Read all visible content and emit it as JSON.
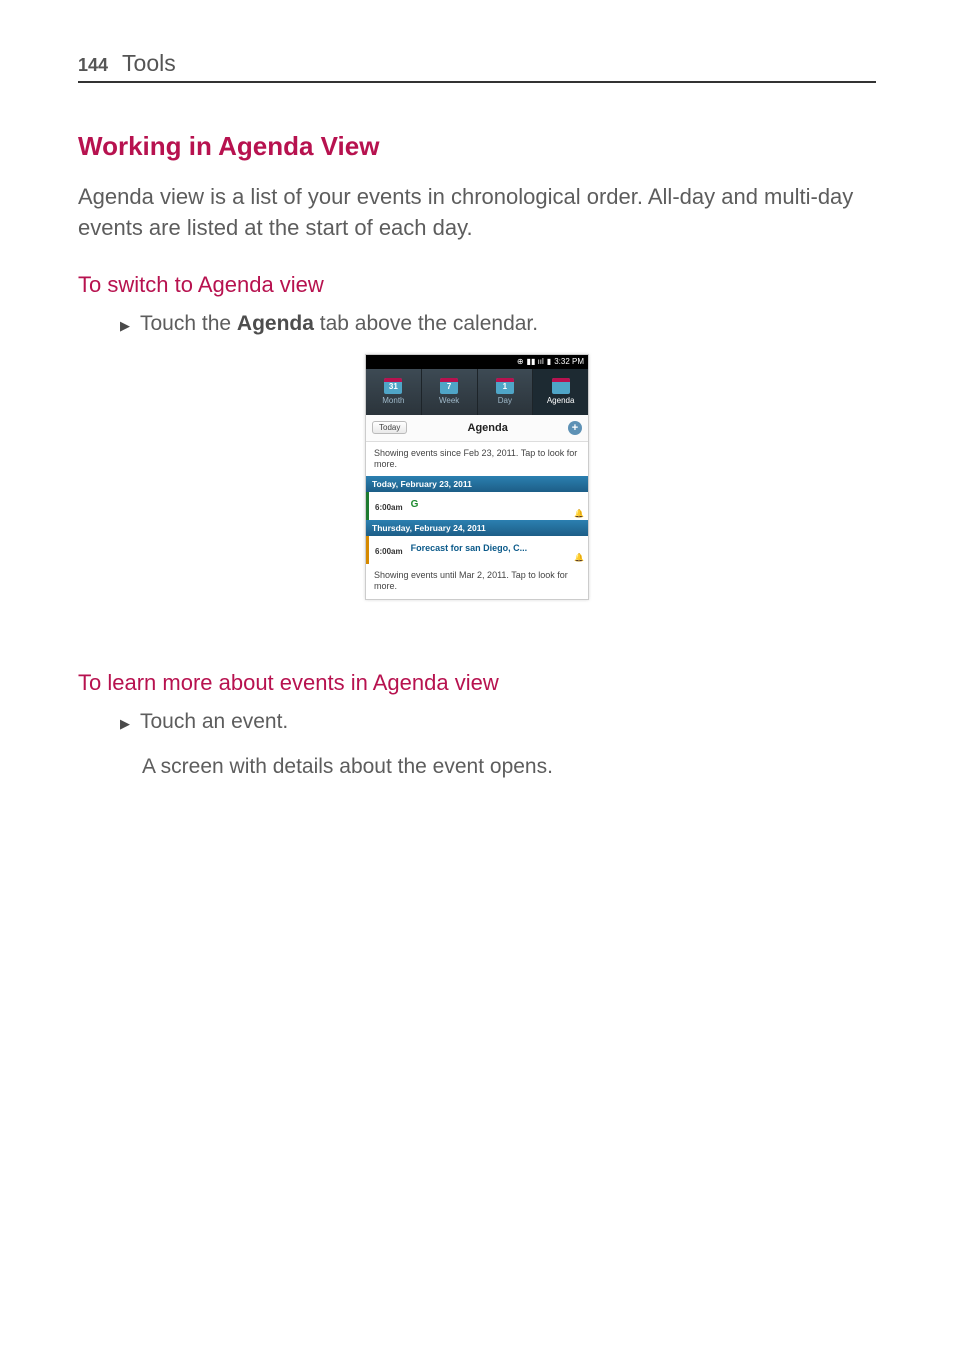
{
  "header": {
    "page_number": "144",
    "chapter": "Tools"
  },
  "section_title": "Working in Agenda View",
  "intro": "Agenda view is a list of your events in chronological order. All-day and multi-day events are listed at the start of each day.",
  "sub1_title": "To switch to Agenda view",
  "sub1_bullet_pre": "Touch the ",
  "sub1_bullet_bold": "Agenda",
  "sub1_bullet_post": " tab above the calendar.",
  "sub2_title": "To learn more about events in Agenda view",
  "sub2_bullet": "Touch an event.",
  "sub2_body": "A screen with details about the event opens.",
  "phone": {
    "status_time": "3:32 PM",
    "tabs": [
      {
        "icon_text": "31",
        "label": "Month"
      },
      {
        "icon_text": "7",
        "label": "Week"
      },
      {
        "icon_text": "1",
        "label": "Day"
      },
      {
        "icon_text": "",
        "label": "Agenda"
      }
    ],
    "today_button": "Today",
    "toolbar_title": "Agenda",
    "scroll_top": "Showing events since Feb 23, 2011. Tap to look for more.",
    "day1_header": "Today, February 23, 2011",
    "day1_time": "6:00am",
    "day1_title": "G",
    "day2_header": "Thursday, February 24, 2011",
    "day2_time": "6:00am",
    "day2_title": "Forecast for san Diego, C...",
    "scroll_bottom": "Showing events until Mar 2, 2011. Tap to look for more."
  }
}
